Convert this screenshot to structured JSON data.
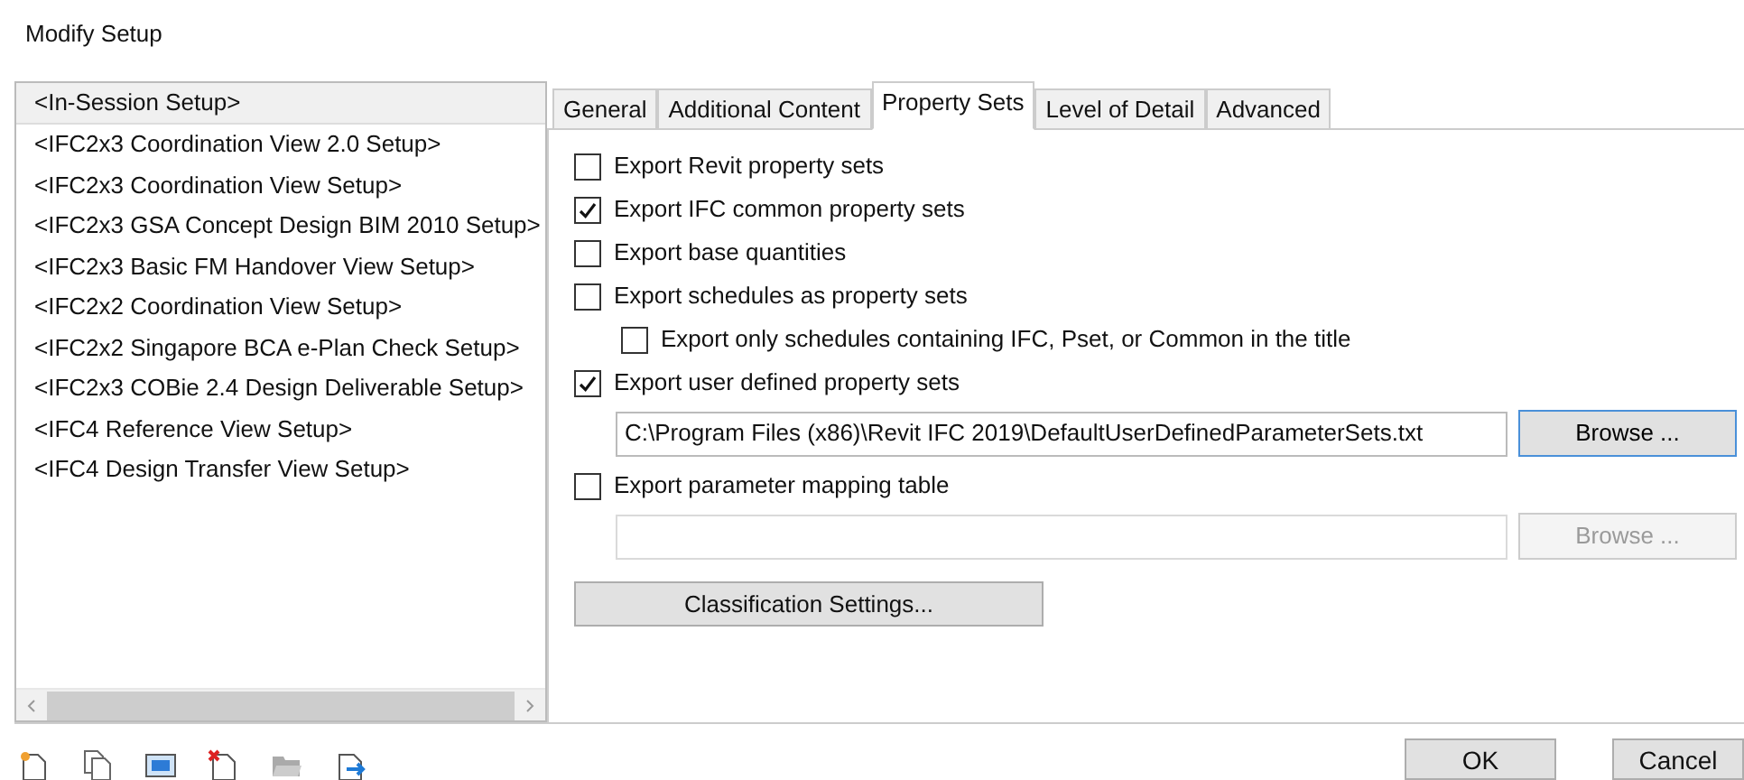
{
  "window": {
    "title": "Modify Setup"
  },
  "setups": [
    {
      "label": "<In-Session Setup>",
      "selected": true
    },
    {
      "label": "<IFC2x3 Coordination View 2.0 Setup>",
      "selected": false
    },
    {
      "label": "<IFC2x3 Coordination View Setup>",
      "selected": false
    },
    {
      "label": "<IFC2x3 GSA Concept Design BIM 2010 Setup>",
      "selected": false
    },
    {
      "label": "<IFC2x3 Basic FM Handover View Setup>",
      "selected": false
    },
    {
      "label": "<IFC2x2 Coordination View Setup>",
      "selected": false
    },
    {
      "label": "<IFC2x2 Singapore BCA e-Plan Check Setup>",
      "selected": false
    },
    {
      "label": "<IFC2x3 COBie 2.4 Design Deliverable Setup>",
      "selected": false
    },
    {
      "label": "<IFC4 Reference View Setup>",
      "selected": false
    },
    {
      "label": "<IFC4 Design Transfer View Setup>",
      "selected": false
    }
  ],
  "tabs": [
    {
      "label": "General",
      "selected": false
    },
    {
      "label": "Additional Content",
      "selected": false
    },
    {
      "label": "Property Sets",
      "selected": true
    },
    {
      "label": "Level of Detail",
      "selected": false
    },
    {
      "label": "Advanced",
      "selected": false
    }
  ],
  "options": [
    {
      "kind": "checkbox",
      "label": "Export Revit property sets",
      "checked": false
    },
    {
      "kind": "checkbox",
      "label": "Export IFC common property sets",
      "checked": true
    },
    {
      "kind": "checkbox",
      "label": "Export base quantities",
      "checked": false
    },
    {
      "kind": "checkbox",
      "label": "Export schedules as property sets",
      "checked": false
    },
    {
      "kind": "subcheckbox",
      "label": "Export only schedules containing IFC, Pset, or Common in the title",
      "checked": false
    },
    {
      "kind": "checkbox",
      "label": "Export user defined property sets",
      "checked": true
    },
    {
      "kind": "file",
      "value": "C:\\Program Files (x86)\\Revit IFC 2019\\DefaultUserDefinedParameterSets.txt",
      "button": "Browse ...",
      "disabled": false
    },
    {
      "kind": "checkbox",
      "label": "Export parameter mapping table",
      "checked": false
    },
    {
      "kind": "file",
      "button": "Browse ...",
      "disabled": true
    },
    {
      "kind": "button",
      "label": "Classification Settings..."
    }
  ],
  "buttons": [
    "OK",
    "Cancel"
  ]
}
